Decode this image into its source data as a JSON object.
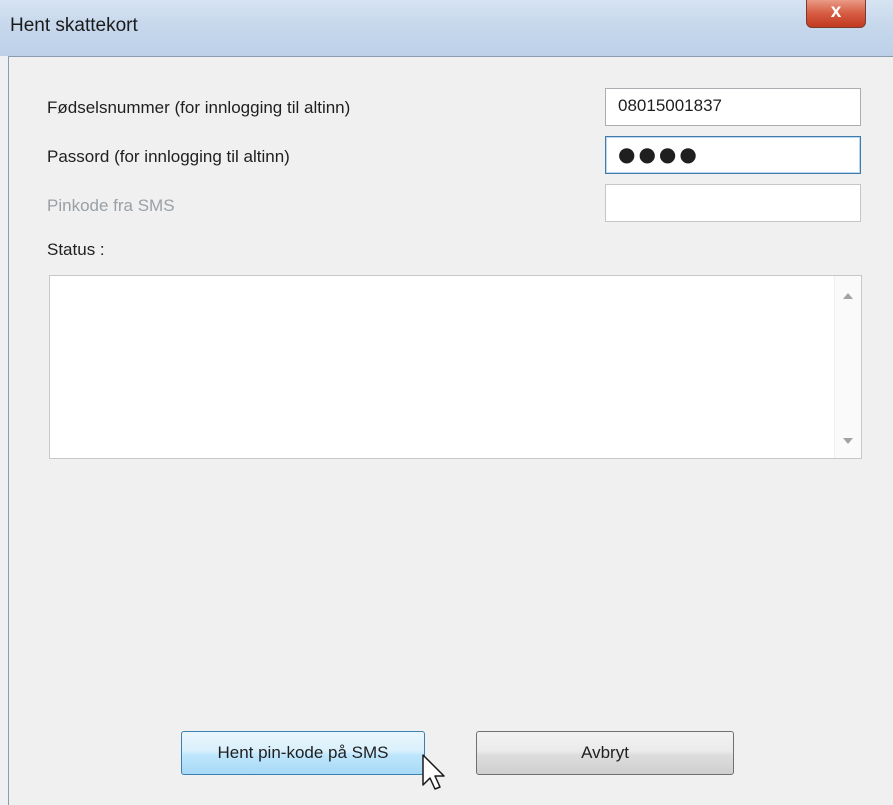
{
  "window": {
    "title": "Hent skattekort",
    "close_symbol": "x"
  },
  "form": {
    "fodselsnummer": {
      "label": "Fødselsnummer (for innlogging til altinn)",
      "value": "08015001837"
    },
    "passord": {
      "label": "Passord (for innlogging til altinn)",
      "value": "●●●●"
    },
    "pinkode": {
      "label": "Pinkode fra SMS",
      "value": ""
    }
  },
  "status": {
    "label": "Status :",
    "text": ""
  },
  "buttons": {
    "primary": "Hent pin-kode på SMS",
    "cancel": "Avbryt"
  },
  "icons": {
    "close": "close-icon",
    "cursor": "mouse-cursor-icon",
    "scroll_up": "scroll-up-arrow-icon",
    "scroll_down": "scroll-down-arrow-icon"
  },
  "colors": {
    "primary_button_border": "#3c7fb1",
    "close_button": "#c13a20",
    "focused_field_border": "#3d7bad"
  }
}
